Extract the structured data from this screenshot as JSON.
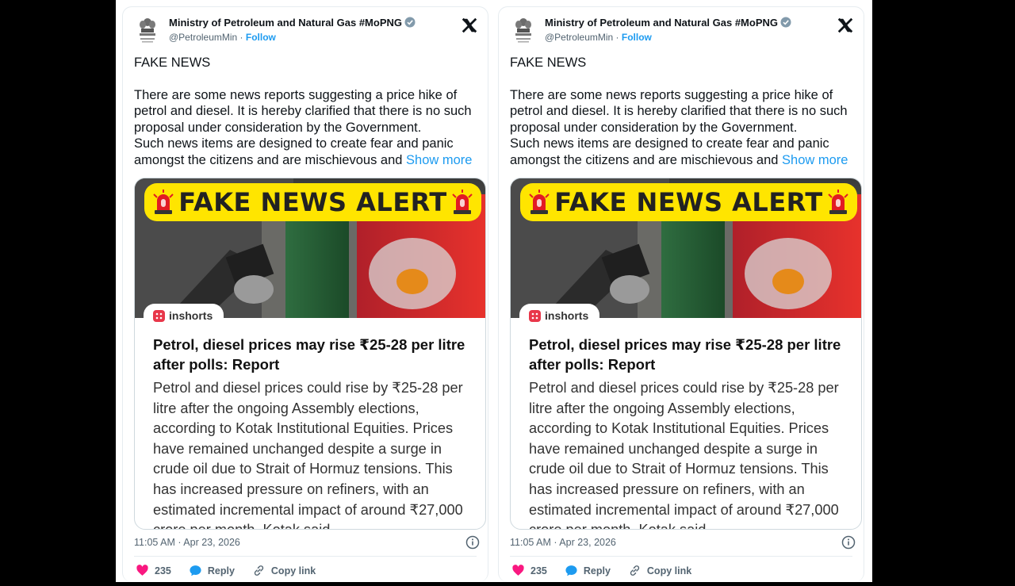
{
  "tweets": [
    {
      "author": {
        "name": "Ministry of Petroleum and Natural Gas #MoPNG",
        "handle": "@PetroleumMin",
        "follow_label": "Follow"
      },
      "text": {
        "lead": "FAKE NEWS",
        "para1": "There are some news reports suggesting a price hike of petrol and diesel. It is hereby clarified that there is no such proposal under consideration by the Government.",
        "para2": "Such news items are designed to create fear and panic amongst the citizens and are mischievous and ",
        "show_more": "Show more"
      },
      "media": {
        "banner": "FAKE NEWS ALERT",
        "source": "inshorts",
        "headline": "Petrol, diesel prices may rise ₹25-28 per litre after polls: Report",
        "body": "Petrol and diesel prices could rise by ₹25-28 per litre after the ongoing Assembly elections, according to Kotak Institutional Equities. Prices have remained unchanged despite a surge in crude oil due to Strait of Hormuz tensions. This has increased pressure on refiners, with an estimated incremental impact of around ₹27,000 crore per month, Kotak said."
      },
      "timestamp": "11:05 AM · Apr 23, 2026",
      "actions": {
        "likes": "235",
        "reply": "Reply",
        "copy": "Copy link"
      }
    },
    {
      "author": {
        "name": "Ministry of Petroleum and Natural Gas #MoPNG",
        "handle": "@PetroleumMin",
        "follow_label": "Follow"
      },
      "text": {
        "lead": "FAKE NEWS",
        "para1": "There are some news reports suggesting a price hike of petrol and diesel. It is hereby clarified that there is no such proposal under consideration by the Government.",
        "para2": "Such news items are designed to create fear and panic amongst the citizens and are mischievous and ",
        "show_more": "Show more"
      },
      "media": {
        "banner": "FAKE NEWS ALERT",
        "source": "inshorts",
        "headline": "Petrol, diesel prices may rise ₹25-28 per litre after polls: Report",
        "body": "Petrol and diesel prices could rise by ₹25-28 per litre after the ongoing Assembly elections, according to Kotak Institutional Equities. Prices have remained unchanged despite a surge in crude oil due to Strait of Hormuz tensions. This has increased pressure on refiners, with an estimated incremental impact of around ₹27,000 crore per month, Kotak said."
      },
      "timestamp": "11:05 AM · Apr 23, 2026",
      "actions": {
        "likes": "235",
        "reply": "Reply",
        "copy": "Copy link"
      }
    }
  ],
  "colors": {
    "accent": "#1d9bf0",
    "banner": "#ffe500",
    "like": "#f91880",
    "text": "#0f1419",
    "muted": "#536471"
  },
  "icons": [
    "emblem-icon",
    "verified-icon",
    "x-logo-icon",
    "siren-icon",
    "inshorts-icon",
    "info-icon",
    "heart-icon",
    "reply-icon",
    "link-icon"
  ]
}
